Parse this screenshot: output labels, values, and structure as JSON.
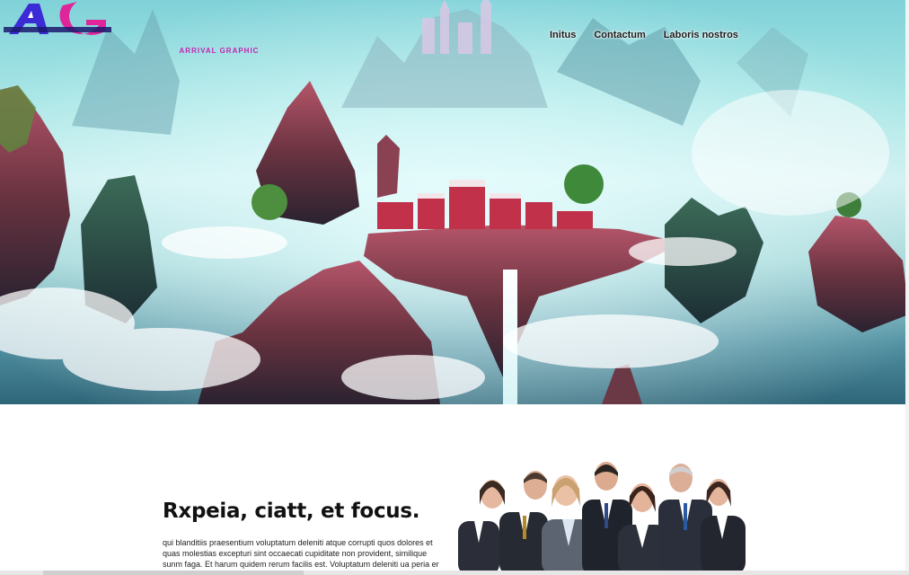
{
  "brand": {
    "logo_text": "ARRIVAL GRAPHIC",
    "logo_colors": [
      "#3b2bd6",
      "#e0249a"
    ]
  },
  "nav": {
    "items": [
      "Initus",
      "Contactum",
      "Laboris nostros"
    ]
  },
  "hero": {
    "image": "fantasy floating mountain landscape with waterfall and city"
  },
  "section": {
    "title": "Rxpeia, ciatt, et focus.",
    "body": "qui blanditiis praesentium voluptatum deleniti atque corrupti quos dolores et quas molestias excepturi sint occaecati cupiditate non provident, similique sunm faga. Et harum quidem rerum facilis est. Voluptatum deleniti ua peria er",
    "image": "group of business people"
  }
}
